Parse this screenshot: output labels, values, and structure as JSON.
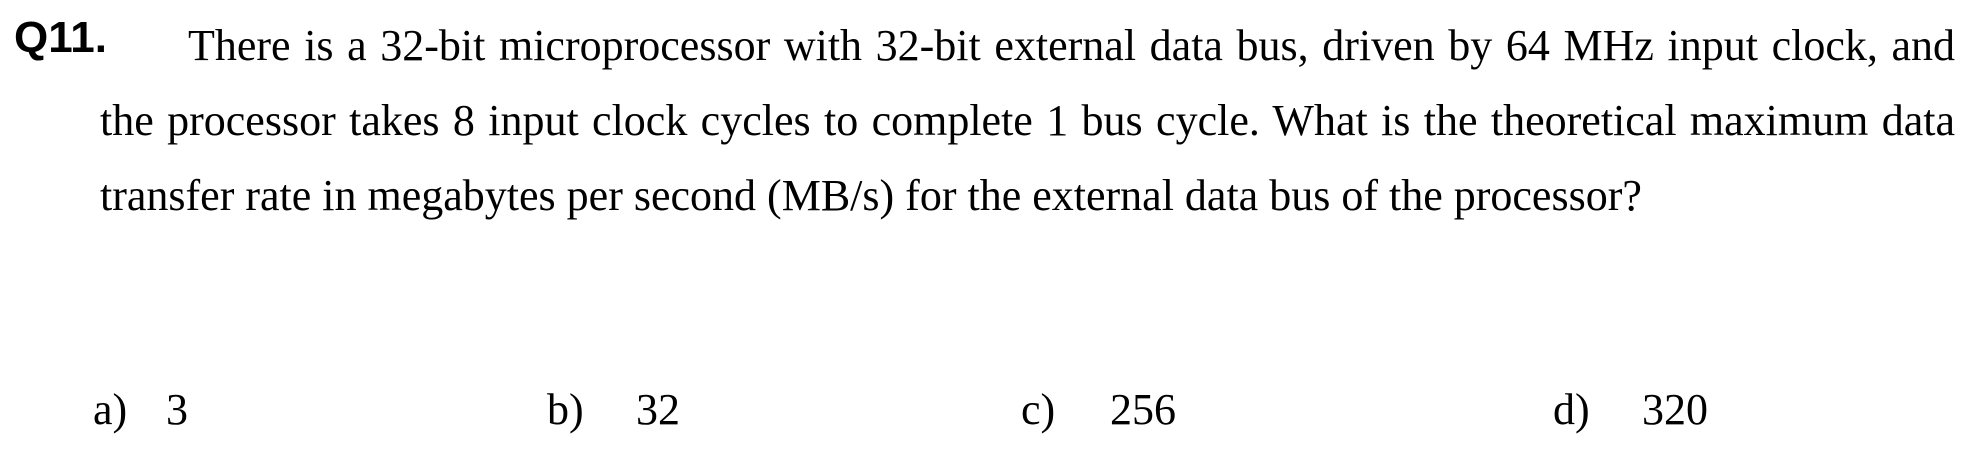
{
  "question": {
    "number": "Q11.",
    "text": "There is a 32-bit microprocessor with 32-bit external data bus, driven by 64 MHz input clock, and the processor takes 8 input clock cycles to complete 1 bus cycle. What is the theoretical maximum data transfer rate in megabytes per second (MB/s) for the external data bus of the processor?"
  },
  "options": [
    {
      "letter": "a)",
      "value": "3"
    },
    {
      "letter": "b)",
      "value": "32"
    },
    {
      "letter": "c)",
      "value": "256"
    },
    {
      "letter": "d)",
      "value": "320"
    }
  ]
}
